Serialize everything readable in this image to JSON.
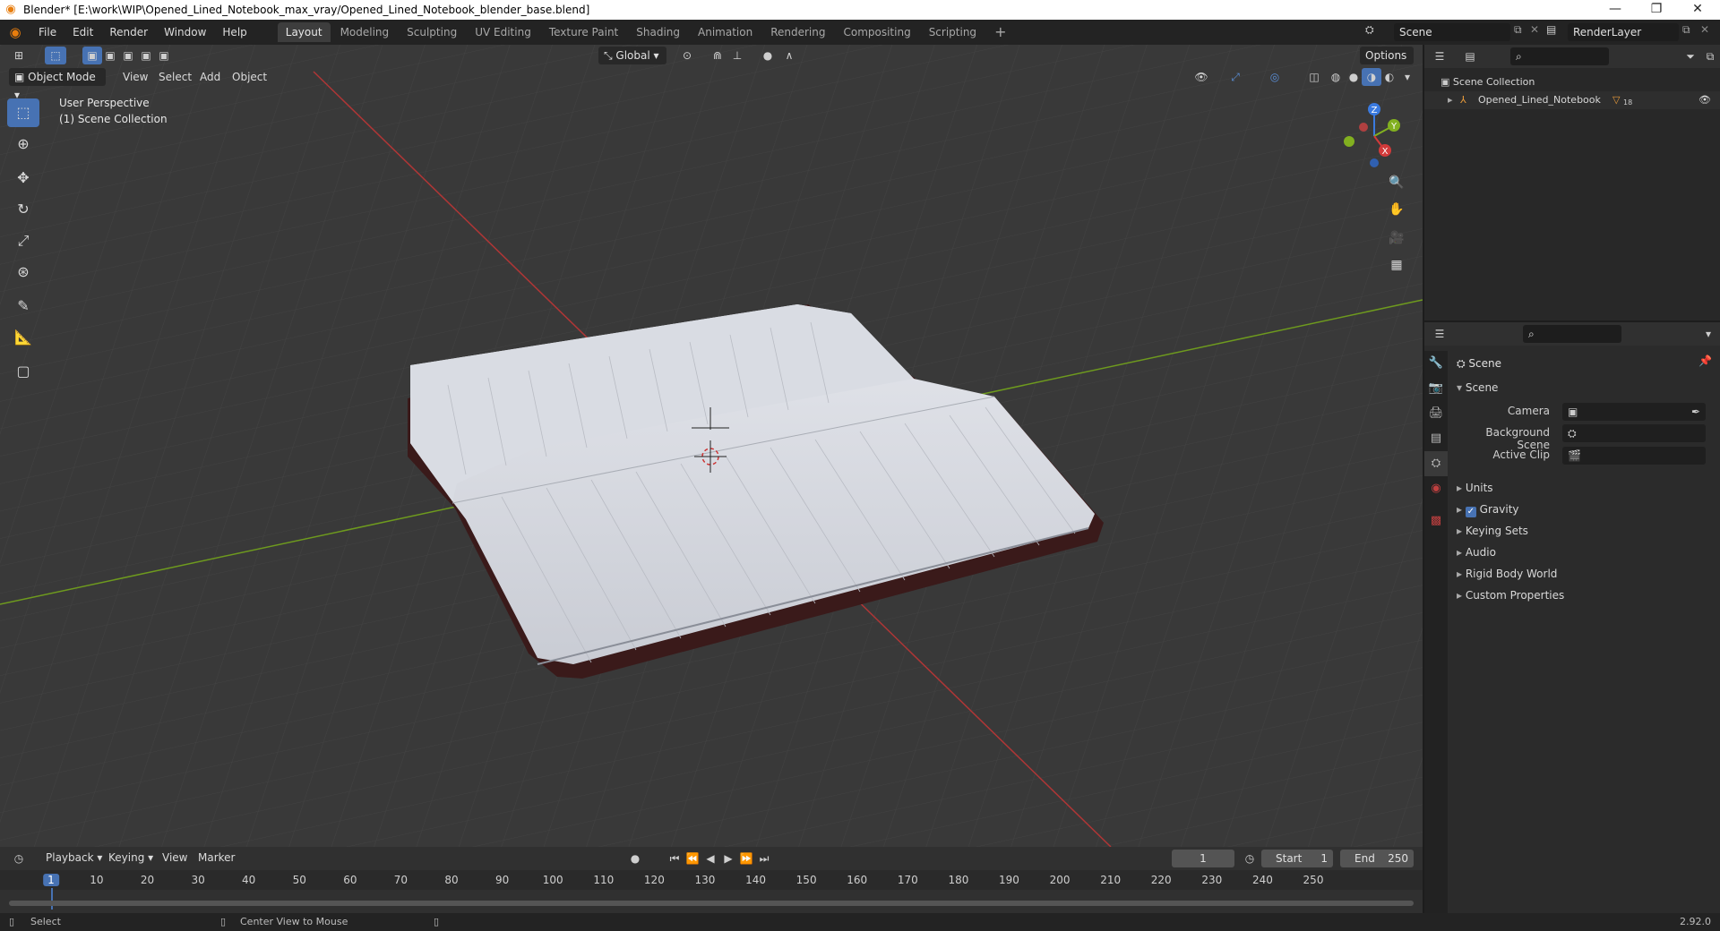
{
  "window": {
    "title": "Blender* [E:\\work\\WIP\\Opened_Lined_Notebook_max_vray/Opened_Lined_Notebook_blender_base.blend]",
    "min": "—",
    "max": "❐",
    "close": "✕"
  },
  "menu": {
    "items": [
      "File",
      "Edit",
      "Render",
      "Window",
      "Help"
    ],
    "workspaces": [
      "Layout",
      "Modeling",
      "Sculpting",
      "UV Editing",
      "Texture Paint",
      "Shading",
      "Animation",
      "Rendering",
      "Compositing",
      "Scripting"
    ],
    "add_tab": "+",
    "scene_name": "Scene",
    "view_layer": "RenderLayer"
  },
  "viewport_header": {
    "mode": "Object Mode",
    "menus": [
      "View",
      "Select",
      "Add",
      "Object"
    ],
    "orientation": "Global",
    "options": "Options"
  },
  "viewport": {
    "perspective": "User Perspective",
    "collection": "(1) Scene Collection",
    "gizmo": {
      "x": "X",
      "y": "Y",
      "z": "Z"
    }
  },
  "outliner": {
    "root": "Scene Collection",
    "items": [
      {
        "name": "Opened_Lined_Notebook",
        "badge": "18"
      }
    ]
  },
  "properties": {
    "context": "Scene",
    "section": "Scene",
    "fields": [
      {
        "label": "Camera"
      },
      {
        "label": "Background Scene"
      },
      {
        "label": "Active Clip"
      }
    ],
    "panels": [
      "Units",
      "Gravity",
      "Keying Sets",
      "Audio",
      "Rigid Body World",
      "Custom Properties"
    ],
    "gravity_checked": true
  },
  "timeline": {
    "menus": [
      "Playback",
      "Keying",
      "View",
      "Marker"
    ],
    "current_frame": "1",
    "start_label": "Start",
    "start": "1",
    "end_label": "End",
    "end": "250",
    "ticks": [
      "1",
      "10",
      "20",
      "30",
      "40",
      "50",
      "60",
      "70",
      "80",
      "90",
      "100",
      "110",
      "120",
      "130",
      "140",
      "150",
      "160",
      "170",
      "180",
      "190",
      "200",
      "210",
      "220",
      "230",
      "240",
      "250"
    ]
  },
  "statusbar": {
    "left": "Select",
    "middle": "Center View to Mouse",
    "version": "2.92.0"
  },
  "colors": {
    "accent": "#4772b3",
    "x_axis": "#d23a3a",
    "y_axis": "#82b020",
    "z_axis": "#3a7ae0"
  }
}
